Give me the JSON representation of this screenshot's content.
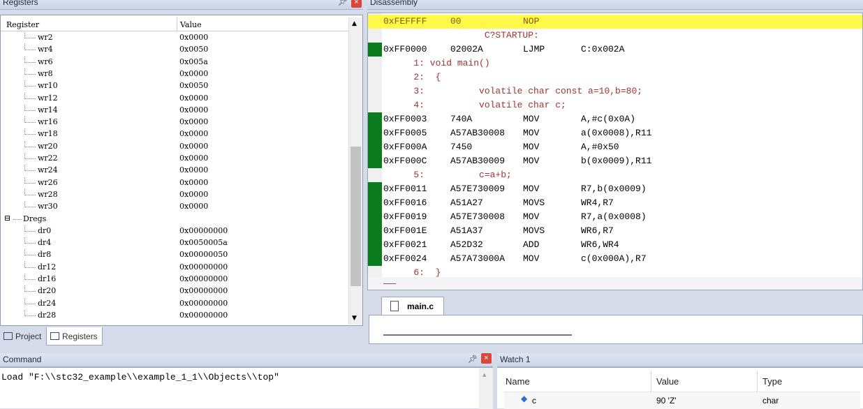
{
  "registers": {
    "title": "Registers",
    "col_register": "Register",
    "col_value": "Value",
    "rows": [
      {
        "name": "wr2",
        "value": "0x0000"
      },
      {
        "name": "wr4",
        "value": "0x0050"
      },
      {
        "name": "wr6",
        "value": "0x005a"
      },
      {
        "name": "wr8",
        "value": "0x0000"
      },
      {
        "name": "wr10",
        "value": "0x0050"
      },
      {
        "name": "wr12",
        "value": "0x0000"
      },
      {
        "name": "wr14",
        "value": "0x0000"
      },
      {
        "name": "wr16",
        "value": "0x0000"
      },
      {
        "name": "wr18",
        "value": "0x0000"
      },
      {
        "name": "wr20",
        "value": "0x0000"
      },
      {
        "name": "wr22",
        "value": "0x0000"
      },
      {
        "name": "wr24",
        "value": "0x0000"
      },
      {
        "name": "wr26",
        "value": "0x0000"
      },
      {
        "name": "wr28",
        "value": "0x0000"
      },
      {
        "name": "wr30",
        "value": "0x0000"
      },
      {
        "name": "Dregs",
        "value": ""
      },
      {
        "name": "dr0",
        "value": "0x00000000"
      },
      {
        "name": "dr4",
        "value": "0x0050005a"
      },
      {
        "name": "dr8",
        "value": "0x00000050"
      },
      {
        "name": "dr12",
        "value": "0x00000000"
      },
      {
        "name": "dr16",
        "value": "0x00000000"
      },
      {
        "name": "dr20",
        "value": "0x00000000"
      },
      {
        "name": "dr24",
        "value": "0x00000000"
      },
      {
        "name": "dr28",
        "value": "0x00000000"
      }
    ],
    "tab_project": "Project",
    "tab_registers": "Registers"
  },
  "disassembly": {
    "title": "Disassembly",
    "lines": [
      {
        "kind": "asm",
        "hl": true,
        "addr": "0xFEFFFF",
        "op": "00",
        "mn": "NOP",
        "arg": ""
      },
      {
        "kind": "src",
        "text": "                C?STARTUP:"
      },
      {
        "kind": "asm",
        "addr": "0xFF0000",
        "op": "02002A",
        "mn": "LJMP",
        "arg": "C:0x002A"
      },
      {
        "kind": "src",
        "text": "   1: void main()"
      },
      {
        "kind": "src",
        "text": "   2:  {"
      },
      {
        "kind": "src",
        "text": "   3:          volatile char const a=10,b=80;"
      },
      {
        "kind": "src",
        "text": "   4:          volatile char c;"
      },
      {
        "kind": "asm",
        "addr": "0xFF0003",
        "op": "740A",
        "mn": "MOV",
        "arg": "A,#c(0x0A)"
      },
      {
        "kind": "asm",
        "addr": "0xFF0005",
        "op": "A57AB30008",
        "mn": "MOV",
        "arg": "a(0x0008),R11"
      },
      {
        "kind": "asm",
        "addr": "0xFF000A",
        "op": "7450",
        "mn": "MOV",
        "arg": "A,#0x50"
      },
      {
        "kind": "asm",
        "addr": "0xFF000C",
        "op": "A57AB30009",
        "mn": "MOV",
        "arg": "b(0x0009),R11"
      },
      {
        "kind": "src",
        "text": "   5:          c=a+b;"
      },
      {
        "kind": "asm",
        "addr": "0xFF0011",
        "op": "A57E730009",
        "mn": "MOV",
        "arg": "R7,b(0x0009)"
      },
      {
        "kind": "asm",
        "addr": "0xFF0016",
        "op": "A51A27",
        "mn": "MOVS",
        "arg": "WR4,R7"
      },
      {
        "kind": "asm",
        "addr": "0xFF0019",
        "op": "A57E730008",
        "mn": "MOV",
        "arg": "R7,a(0x0008)"
      },
      {
        "kind": "asm",
        "addr": "0xFF001E",
        "op": "A51A37",
        "mn": "MOVS",
        "arg": "WR6,R7"
      },
      {
        "kind": "asm",
        "addr": "0xFF0021",
        "op": "A52D32",
        "mn": "ADD",
        "arg": "WR6,WR4"
      },
      {
        "kind": "asm",
        "addr": "0xFF0024",
        "op": "A57A73000A",
        "mn": "MOV",
        "arg": "c(0x000A),R7"
      },
      {
        "kind": "src",
        "text": "   6:  }"
      }
    ]
  },
  "source_tab": {
    "label": "main.c"
  },
  "command": {
    "title": "Command",
    "text": "Load \"F:\\\\stc32_example\\\\example_1_1\\\\Objects\\\\top\""
  },
  "watch": {
    "title": "Watch 1",
    "col_name": "Name",
    "col_value": "Value",
    "col_type": "Type",
    "rows": [
      {
        "name": "c",
        "value": "90 'Z'",
        "type": "char"
      }
    ]
  }
}
